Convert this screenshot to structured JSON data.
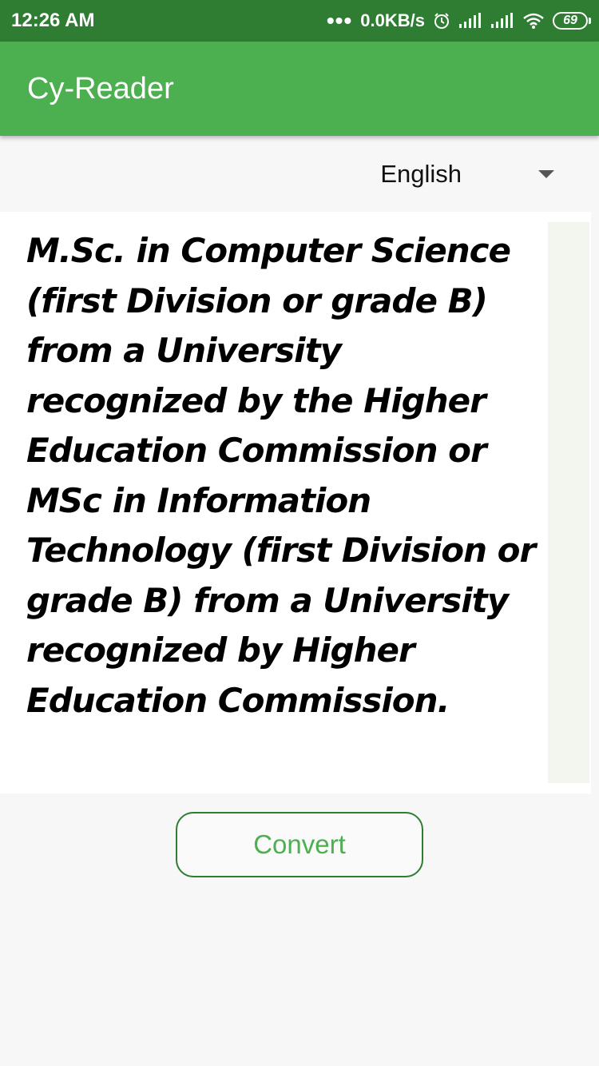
{
  "status_bar": {
    "time": "12:26 AM",
    "dots": "•••",
    "network_speed": "0.0KB/s",
    "battery": "69",
    "icons": [
      "alarm-icon",
      "signal-icon",
      "signal-icon",
      "wifi-icon",
      "battery-icon"
    ]
  },
  "app_bar": {
    "title": "Cy-Reader"
  },
  "language_selector": {
    "selected": "English"
  },
  "document": {
    "text": "M.Sc. in Computer Science (first Division or grade B) from a University recognized by the Higher Education Commission or MSc in Information Technology (first Division or grade B) from a University recognized by Higher Education Commission."
  },
  "actions": {
    "convert_label": "Convert"
  },
  "colors": {
    "status_bar": "#2e7d32",
    "app_bar": "#4caf50",
    "accent": "#4caf50",
    "background": "#f7f7f7"
  }
}
